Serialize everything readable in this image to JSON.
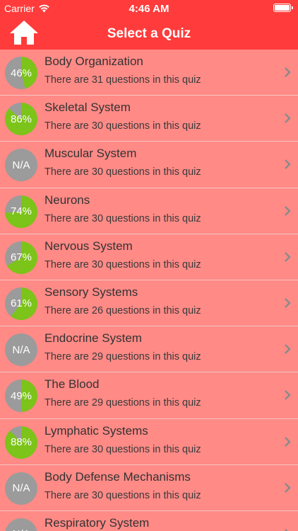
{
  "status_bar": {
    "carrier": "Carrier",
    "time": "4:46 AM"
  },
  "nav": {
    "title": "Select a Quiz"
  },
  "colors": {
    "header": "#ff3b3b",
    "row_bg": "#ff8a86",
    "progress": "#7cc31a",
    "pie_bg": "#9b9b9b"
  },
  "quizzes": [
    {
      "title": "Body Organization",
      "subtitle": "There are 31 questions in this quiz",
      "score_label": "46%",
      "score": 46
    },
    {
      "title": "Skeletal System",
      "subtitle": "There are 30 questions in this quiz",
      "score_label": "86%",
      "score": 86
    },
    {
      "title": "Muscular System",
      "subtitle": "There are 30 questions in this quiz",
      "score_label": "N/A",
      "score": null
    },
    {
      "title": "Neurons",
      "subtitle": "There are 30 questions in this quiz",
      "score_label": "74%",
      "score": 74
    },
    {
      "title": "Nervous System",
      "subtitle": "There are 30 questions in this quiz",
      "score_label": "67%",
      "score": 67
    },
    {
      "title": "Sensory Systems",
      "subtitle": "There are 26 questions in this quiz",
      "score_label": "61%",
      "score": 61
    },
    {
      "title": "Endocrine System",
      "subtitle": "There are 29 questions in this quiz",
      "score_label": "N/A",
      "score": null
    },
    {
      "title": "The Blood",
      "subtitle": "There are 29 questions in this quiz",
      "score_label": "49%",
      "score": 49
    },
    {
      "title": "Lymphatic Systems",
      "subtitle": "There are 30 questions in this quiz",
      "score_label": "88%",
      "score": 88
    },
    {
      "title": "Body Defense Mechanisms",
      "subtitle": "There are 30 questions in this quiz",
      "score_label": "N/A",
      "score": null
    },
    {
      "title": "Respiratory System",
      "subtitle": "",
      "score_label": "N/A",
      "score": null
    }
  ]
}
